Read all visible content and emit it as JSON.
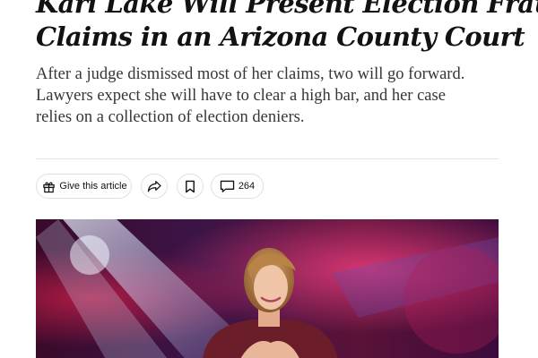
{
  "article": {
    "headline_lines": [
      "Kari Lake Will Present Election Fraud",
      "Claims in an Arizona County Court"
    ],
    "summary_lines": [
      "After a judge dismissed most of her claims, two will go forward.",
      "Lawyers expect she will have to clear a high bar, and her case",
      "relies on a collection of election deniers."
    ]
  },
  "toolbar": {
    "gift_label": "Give this article",
    "gift_icon": "gift-icon",
    "share_icon": "share-arrow-icon",
    "save_icon": "bookmark-icon",
    "comments_icon": "comment-bubble-icon",
    "comment_count": "264"
  },
  "hero_image": {
    "subject": "photo of Kari Lake speaking on stage"
  },
  "colors": {
    "text": "#121212",
    "summary_text": "#363636",
    "pill_border": "#dfdfdf"
  }
}
